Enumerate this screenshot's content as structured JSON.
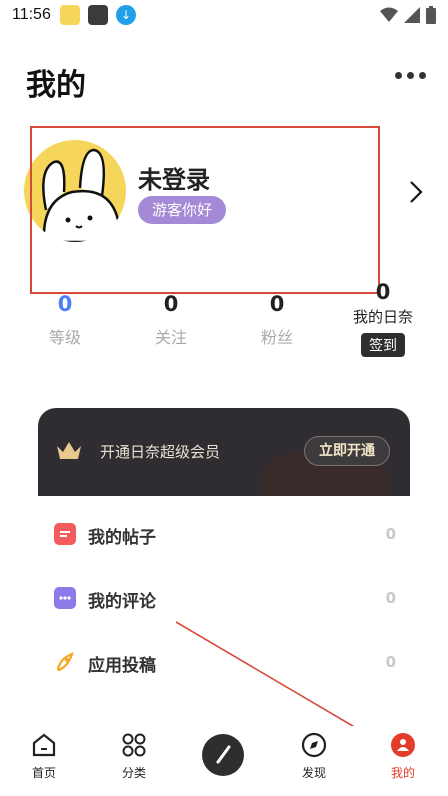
{
  "status_bar": {
    "time": "11:56"
  },
  "header": {
    "title": "我的"
  },
  "profile": {
    "nickname": "未登录",
    "badge": "游客你好"
  },
  "stats": [
    {
      "value": "0",
      "label": "等级"
    },
    {
      "value": "0",
      "label": "关注"
    },
    {
      "value": "0",
      "label": "粉丝"
    }
  ],
  "checkin": {
    "count": "0",
    "label": "我的日奈",
    "button": "签到"
  },
  "vip": {
    "text": "开通日奈超级会员",
    "button": "立即开通"
  },
  "menu": [
    {
      "label": "我的帖子",
      "count": "0"
    },
    {
      "label": "我的评论",
      "count": "0"
    },
    {
      "label": "应用投稿",
      "count": "0"
    }
  ],
  "bottom_nav": [
    {
      "label": "首页"
    },
    {
      "label": "分类"
    },
    {
      "label": "发现"
    },
    {
      "label": "我的"
    }
  ],
  "colors": {
    "accent": "#e53b2c",
    "level": "#4a7ff5",
    "badge": "#a48ad6",
    "vip_bg": "#2f2d31"
  }
}
